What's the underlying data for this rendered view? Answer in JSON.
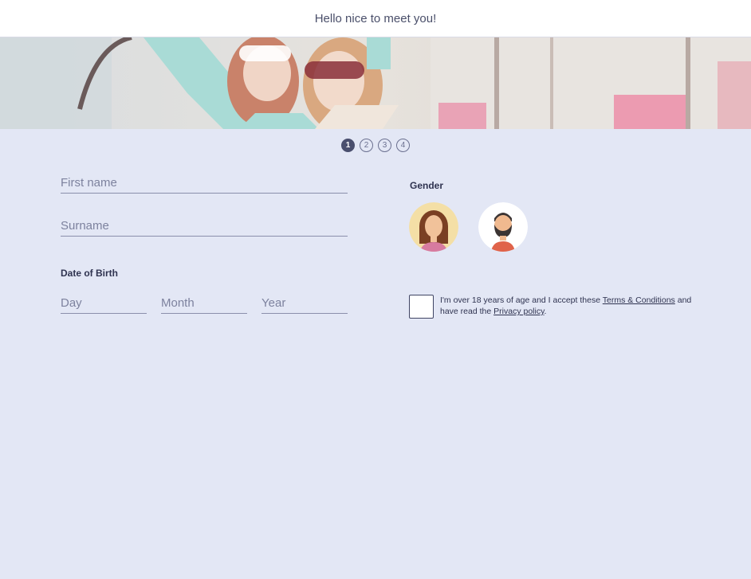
{
  "header": {
    "title": "Hello nice to meet you!"
  },
  "steps": [
    {
      "label": "1",
      "active": true
    },
    {
      "label": "2",
      "active": false
    },
    {
      "label": "3",
      "active": false
    },
    {
      "label": "4",
      "active": false
    }
  ],
  "form": {
    "first_name": {
      "placeholder": "First name",
      "value": ""
    },
    "surname": {
      "placeholder": "Surname",
      "value": ""
    },
    "dob_label": "Date of Birth",
    "day": {
      "placeholder": "Day",
      "value": ""
    },
    "month": {
      "placeholder": "Month",
      "value": ""
    },
    "year": {
      "placeholder": "Year",
      "value": ""
    },
    "gender_label": "Gender",
    "gender_options": [
      {
        "value": "female",
        "icon": "female-avatar-icon"
      },
      {
        "value": "male",
        "icon": "male-avatar-icon"
      }
    ],
    "consent": {
      "checked": false,
      "text_before": "I'm over 18 years of age and I accept these ",
      "terms_link": "Terms & Conditions",
      "text_middle": " and have read the ",
      "privacy_link": "Privacy policy",
      "text_after": "."
    }
  },
  "colors": {
    "background": "#e3e7f5",
    "accent": "#4a4f6e",
    "header_bg": "#ffffff"
  }
}
